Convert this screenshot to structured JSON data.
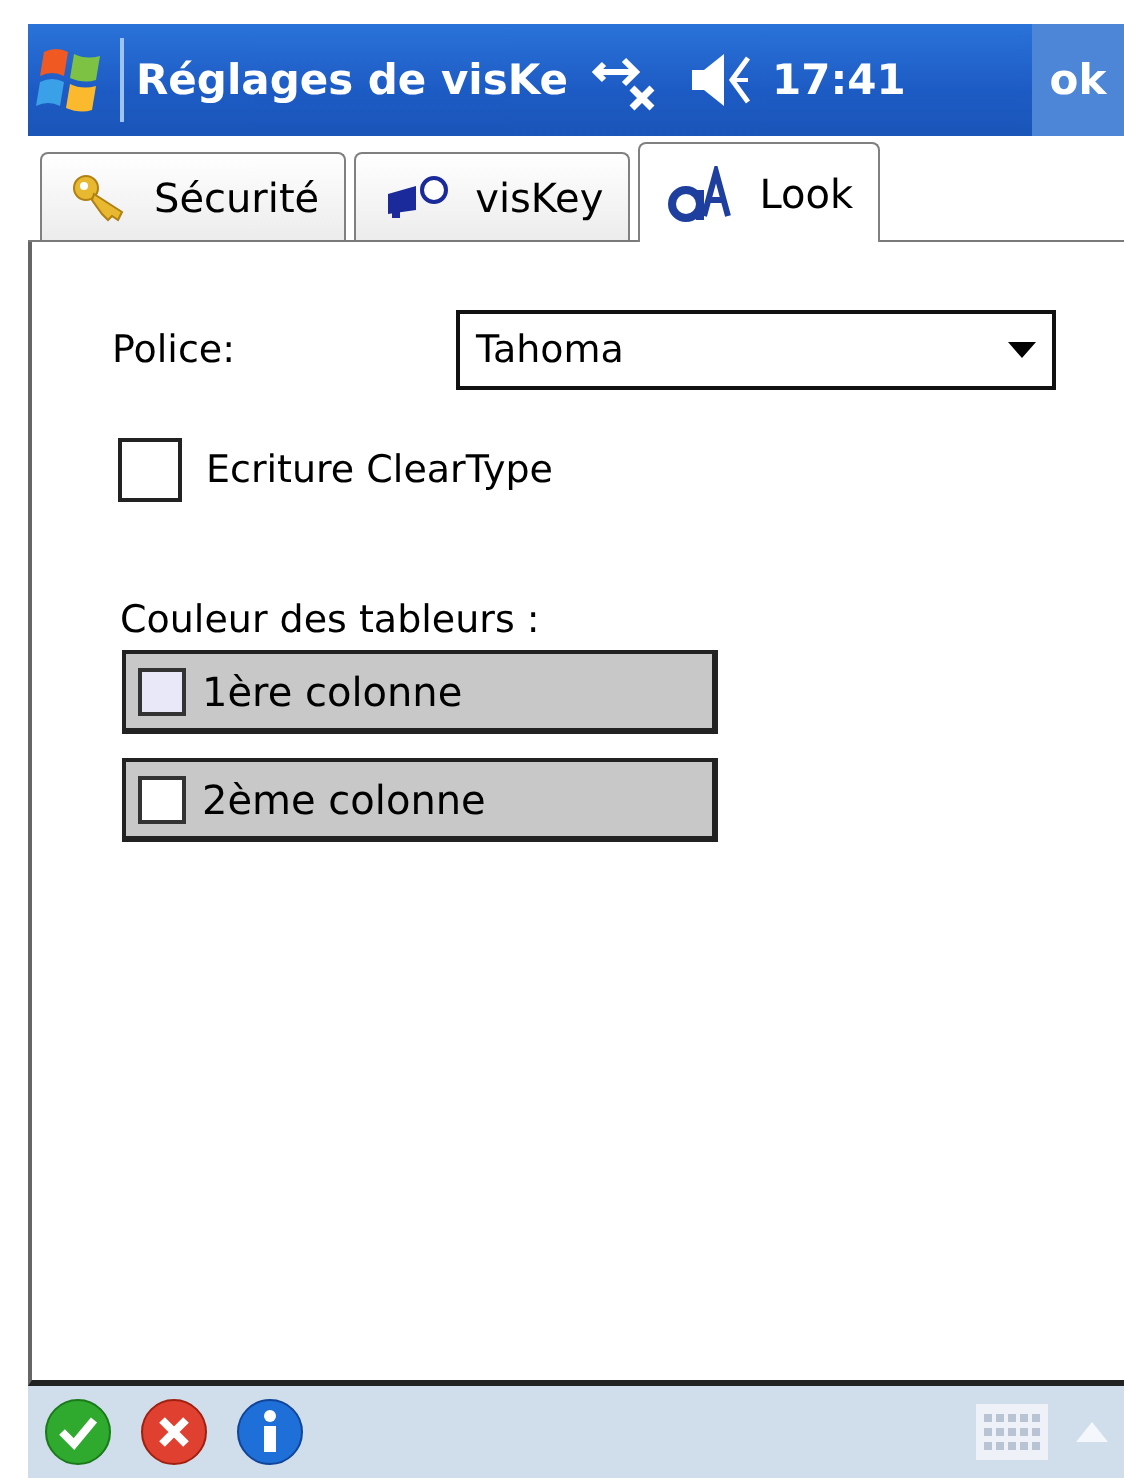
{
  "title_bar": {
    "title": "Réglages de visKe",
    "time": "17:41",
    "ok_label": "ok"
  },
  "tabs": [
    {
      "label": "Sécurité",
      "kind": "key",
      "selected": false
    },
    {
      "label": "visKey",
      "kind": "projector",
      "selected": false
    },
    {
      "label": "Look",
      "kind": "font",
      "selected": true
    }
  ],
  "font_field": {
    "label": "Police:",
    "value": "Tahoma"
  },
  "cleartype": {
    "label": "Ecriture ClearType",
    "checked": false
  },
  "colors_section": {
    "label": "Couleur des tableurs :",
    "buttons": [
      {
        "label": "1ère colonne",
        "color": "#e8e8f8"
      },
      {
        "label": "2ème colonne",
        "color": "#ffffff"
      }
    ]
  },
  "bottom_bar": {
    "buttons": [
      {
        "kind": "ok"
      },
      {
        "kind": "cancel"
      },
      {
        "kind": "info"
      }
    ]
  }
}
